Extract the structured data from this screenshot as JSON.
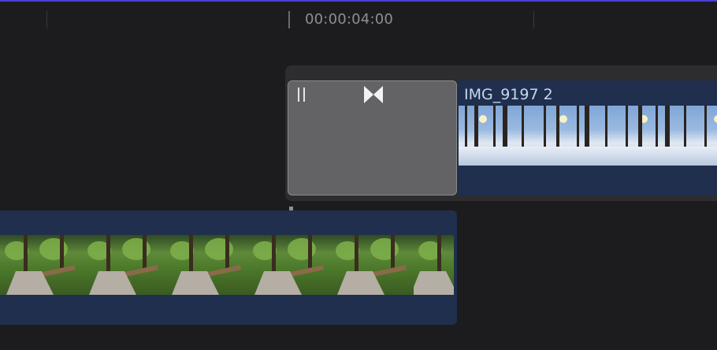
{
  "ruler": {
    "timecode": "00:00:04:00"
  },
  "clips": {
    "top_clip_title": "IMG_9197 2"
  },
  "colors": {
    "accent_line": "#4b3fd6",
    "clip_fill": "#1f2f4d",
    "transition_fill": "#636365",
    "timeline_bg": "#1c1c1e"
  },
  "icons": {
    "transition_pause": "pause-icon",
    "transition_bowtie": "cross-dissolve-icon"
  }
}
